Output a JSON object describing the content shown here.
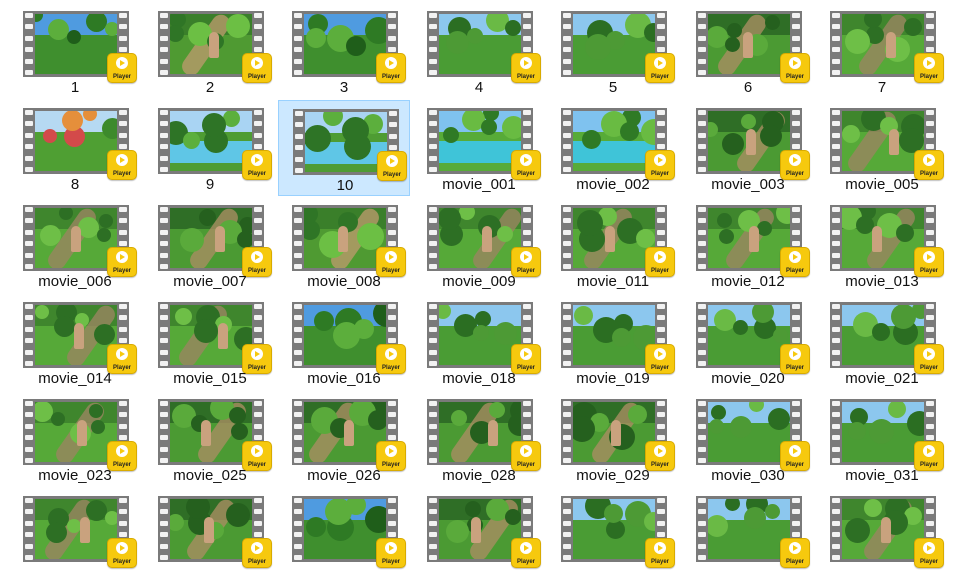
{
  "badge_label": "Player",
  "colors": {
    "selection_bg": "#cce8ff",
    "selection_border": "#99d1ff",
    "badge": "#f6c90e",
    "filmstrip": "#7a7a7a"
  },
  "icon": "video-file-icon",
  "selected_file": "10",
  "files": [
    {
      "name": "1",
      "scene": "sky"
    },
    {
      "name": "2",
      "scene": "path"
    },
    {
      "name": "3",
      "scene": "sky"
    },
    {
      "name": "4",
      "scene": "forest"
    },
    {
      "name": "5",
      "scene": "forest"
    },
    {
      "name": "6",
      "scene": "figure"
    },
    {
      "name": "7",
      "scene": "grass"
    },
    {
      "name": "8",
      "scene": "autumn"
    },
    {
      "name": "9",
      "scene": "river"
    },
    {
      "name": "10",
      "scene": "river"
    },
    {
      "name": "movie_001",
      "scene": "water"
    },
    {
      "name": "movie_002",
      "scene": "water"
    },
    {
      "name": "movie_003",
      "scene": "figure"
    },
    {
      "name": "movie_005",
      "scene": "grass"
    },
    {
      "name": "movie_006",
      "scene": "grass"
    },
    {
      "name": "movie_007",
      "scene": "figure"
    },
    {
      "name": "movie_008",
      "scene": "path"
    },
    {
      "name": "movie_009",
      "scene": "grass"
    },
    {
      "name": "movie_011",
      "scene": "grass"
    },
    {
      "name": "movie_012",
      "scene": "grass"
    },
    {
      "name": "movie_013",
      "scene": "grass"
    },
    {
      "name": "movie_014",
      "scene": "grass"
    },
    {
      "name": "movie_015",
      "scene": "grass"
    },
    {
      "name": "movie_016",
      "scene": "sky"
    },
    {
      "name": "movie_018",
      "scene": "forest"
    },
    {
      "name": "movie_019",
      "scene": "forest"
    },
    {
      "name": "movie_020",
      "scene": "forest"
    },
    {
      "name": "movie_021",
      "scene": "forest"
    },
    {
      "name": "movie_023",
      "scene": "grass"
    },
    {
      "name": "movie_025",
      "scene": "figure"
    },
    {
      "name": "movie_026",
      "scene": "figure"
    },
    {
      "name": "movie_028",
      "scene": "figure"
    },
    {
      "name": "movie_029",
      "scene": "figure"
    },
    {
      "name": "movie_030",
      "scene": "forest"
    },
    {
      "name": "movie_031",
      "scene": "forest"
    },
    {
      "name": "",
      "scene": "grass"
    },
    {
      "name": "",
      "scene": "figure"
    },
    {
      "name": "",
      "scene": "sky"
    },
    {
      "name": "",
      "scene": "figure"
    },
    {
      "name": "",
      "scene": "forest"
    },
    {
      "name": "",
      "scene": "forest"
    },
    {
      "name": "",
      "scene": "grass"
    }
  ]
}
